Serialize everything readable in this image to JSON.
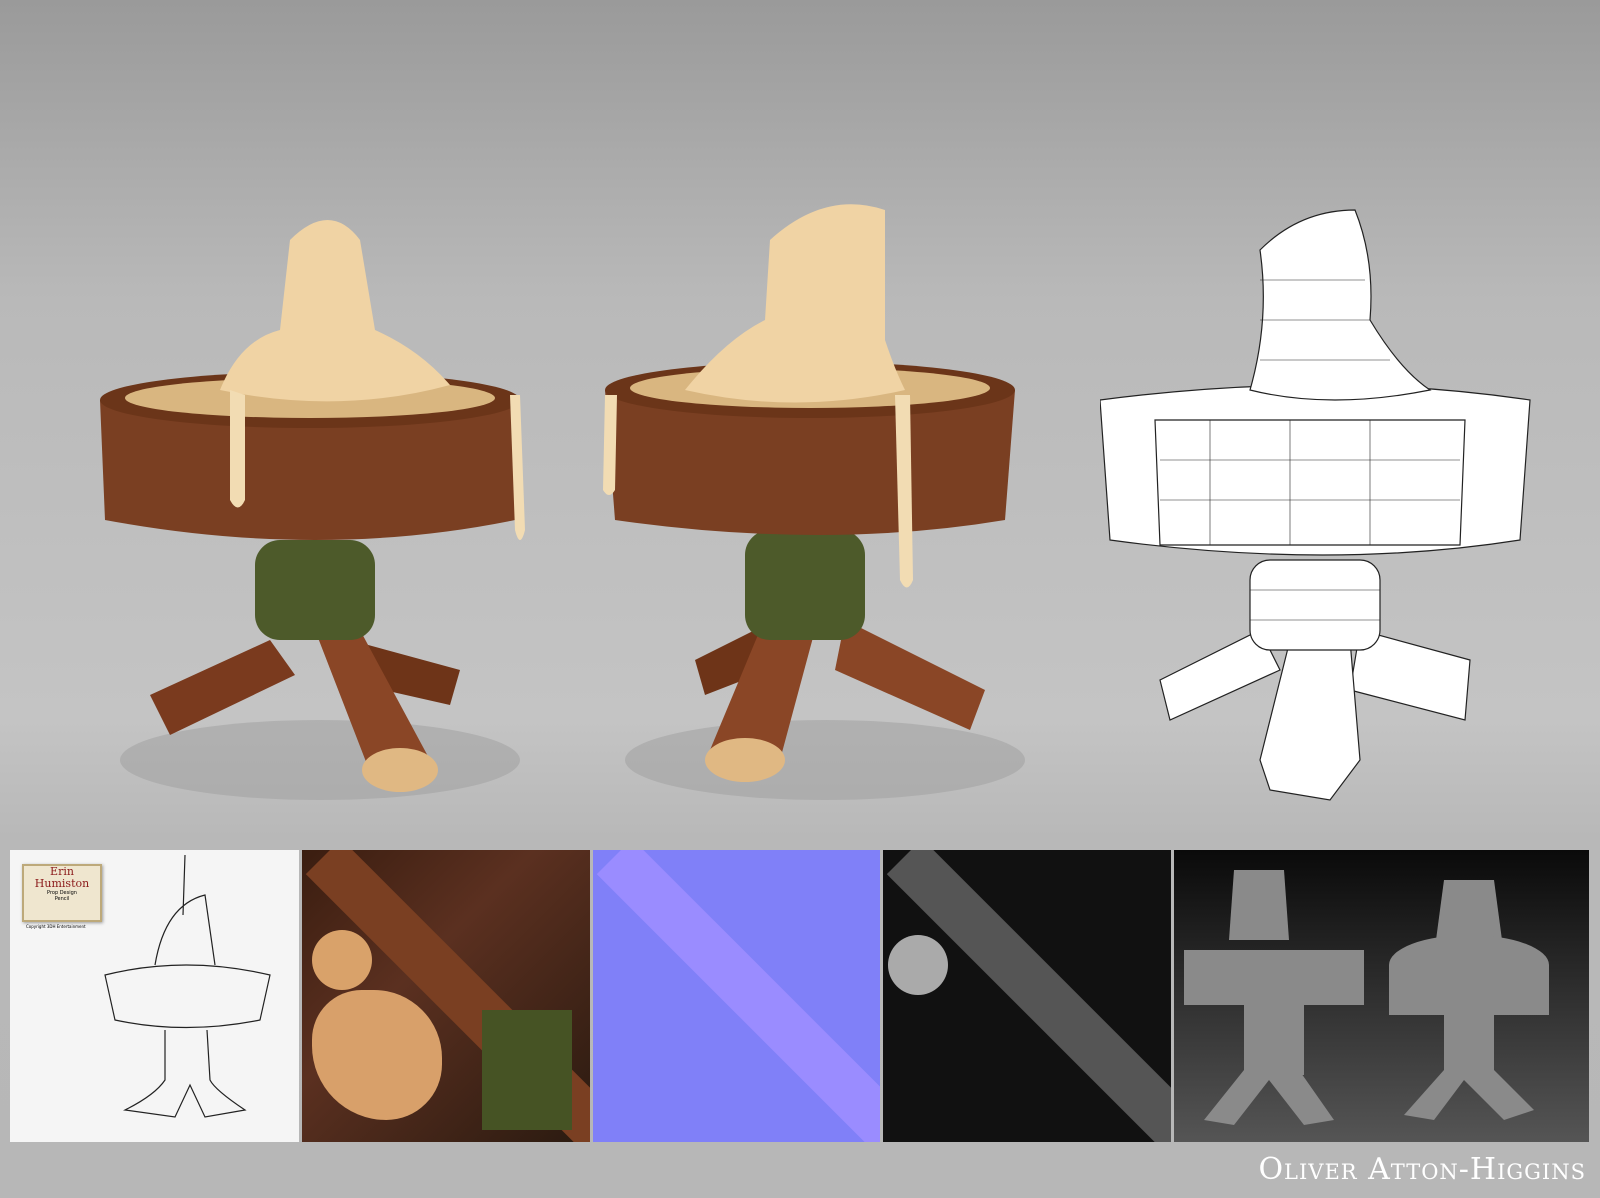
{
  "artist_signature": "Oliver Atton-Higgins",
  "concept_logo": {
    "title_line1": "Erin",
    "title_line2": "Humiston",
    "subtitle": "Prop Design",
    "medium": "Pencil",
    "copyright": "Copyright 3DH Entertainment"
  },
  "colors": {
    "wood": "#7a3f22",
    "wax": "#f0d3a4",
    "rope": "#4d5a2a",
    "normal_map": "#7f7fff"
  }
}
